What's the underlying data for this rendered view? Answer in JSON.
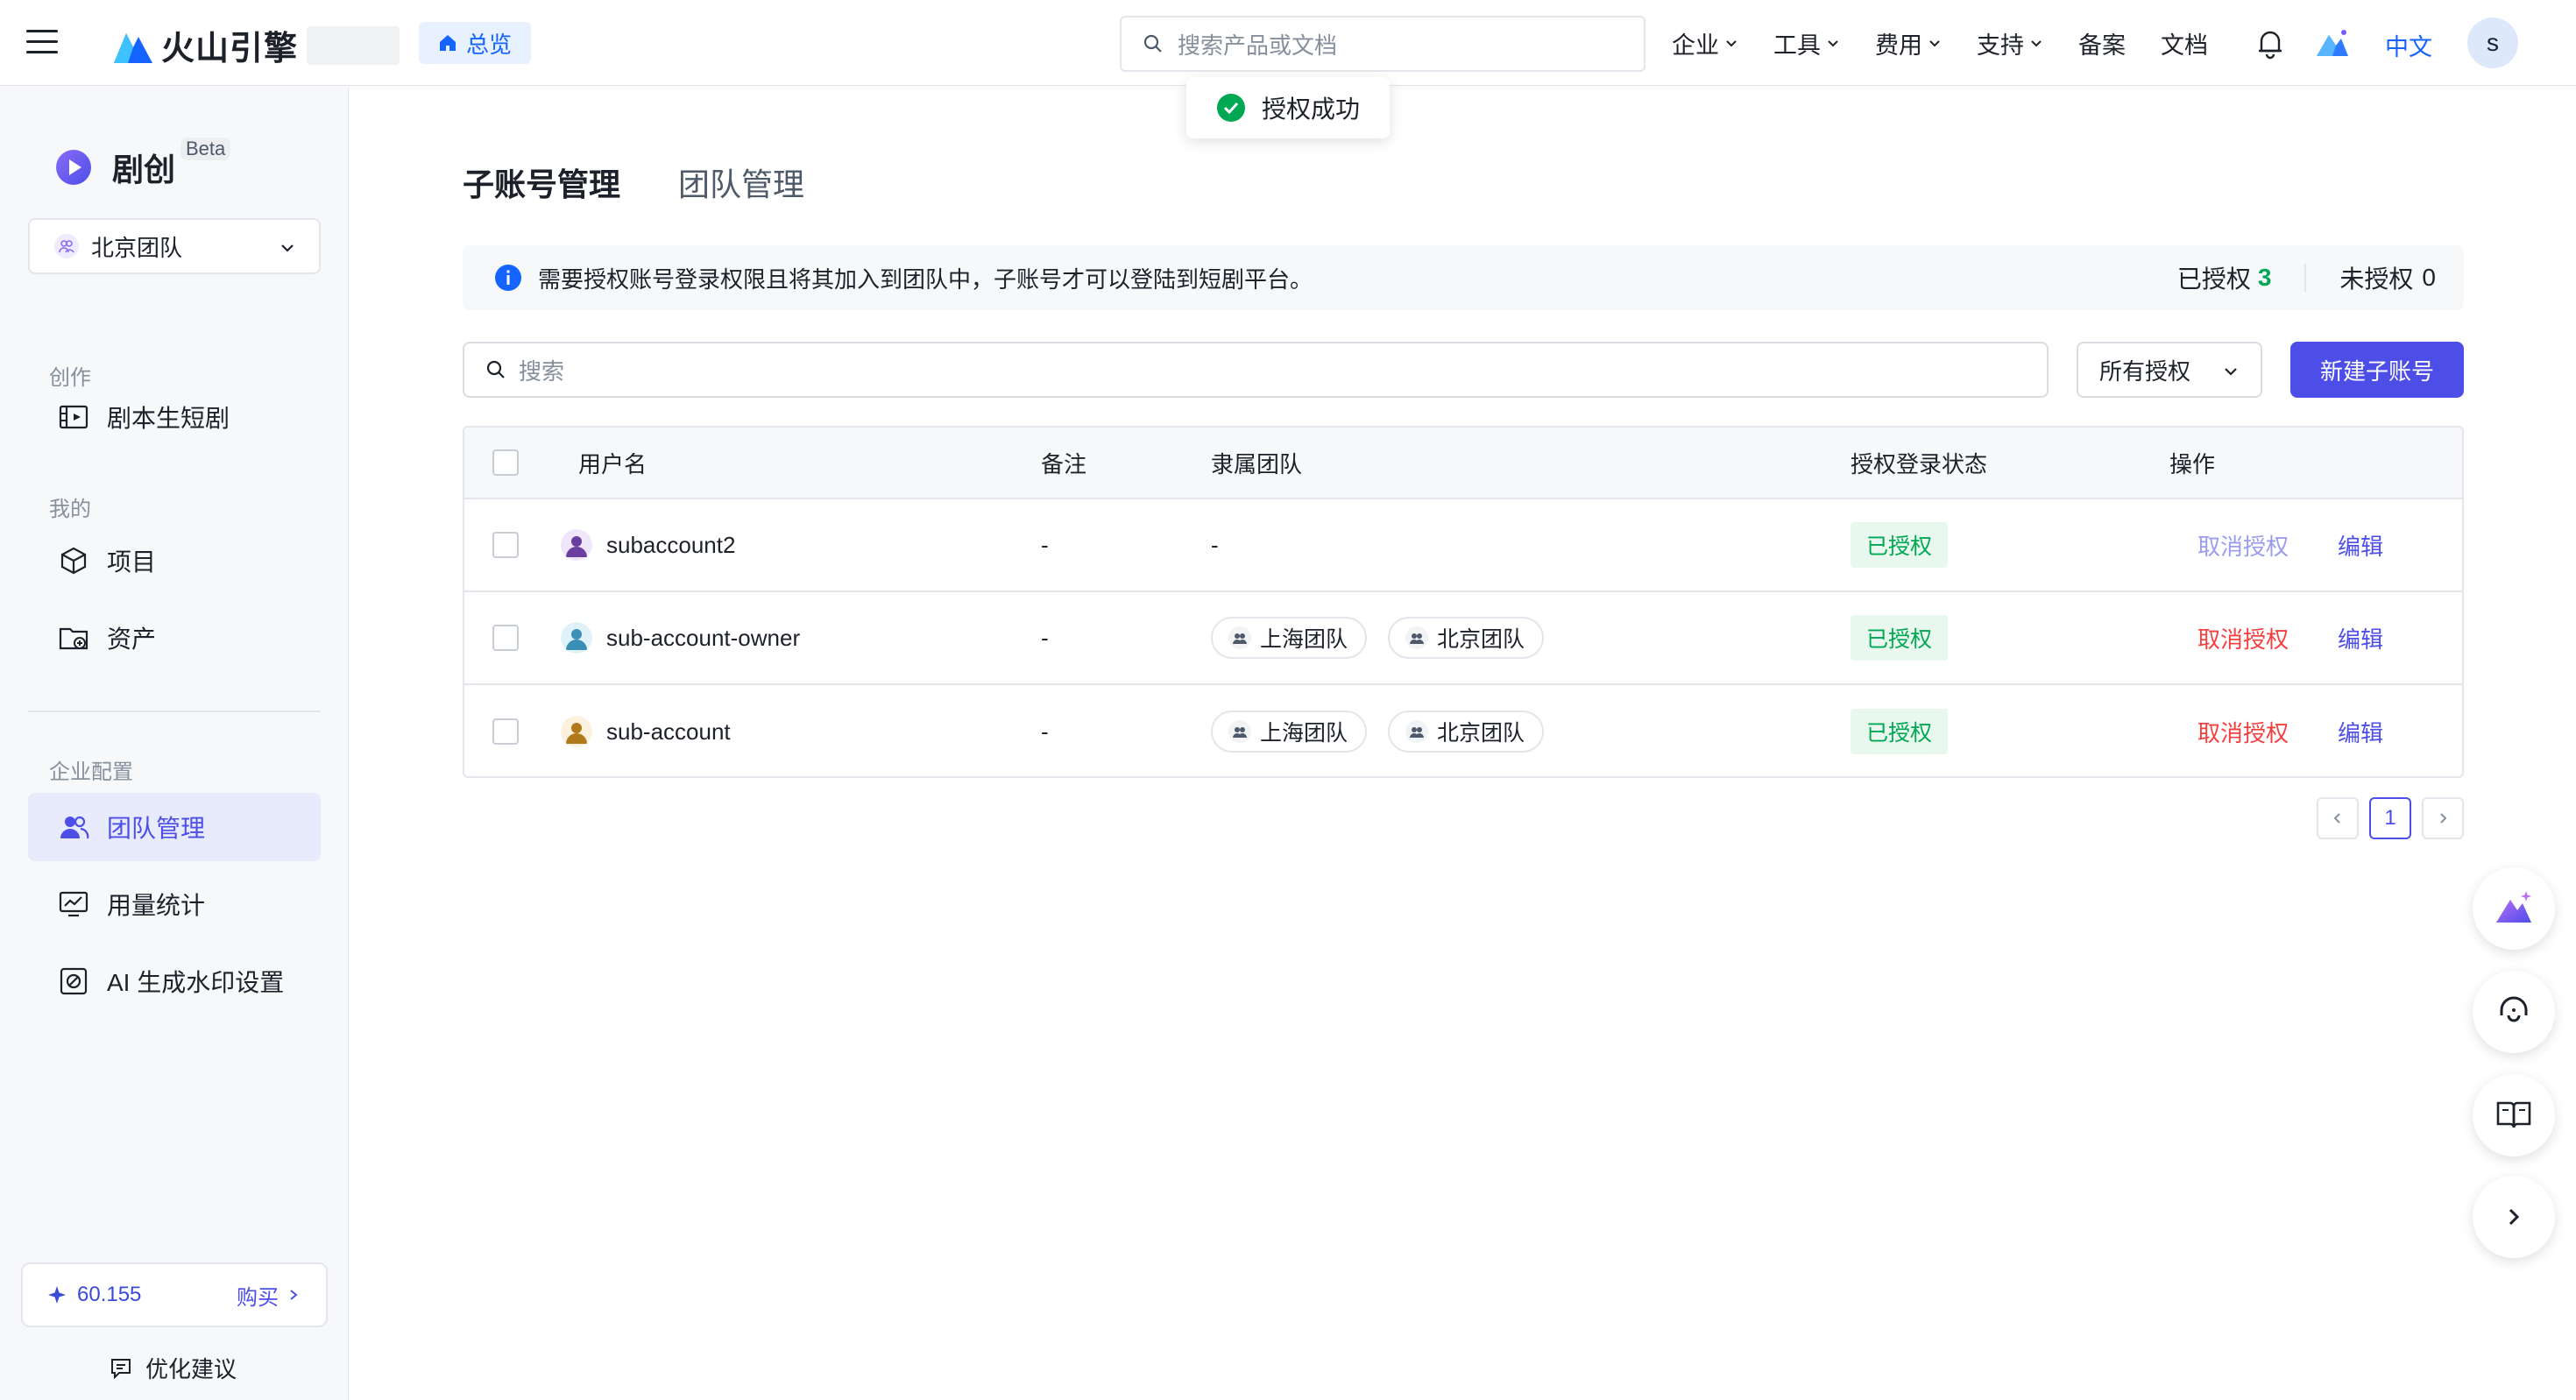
{
  "topbar": {
    "brand": "火山引擎",
    "overview": "总览",
    "search_placeholder": "搜索产品或文档",
    "nav": [
      "企业",
      "工具",
      "费用",
      "支持",
      "备案",
      "文档"
    ],
    "lang": "中文",
    "avatar": "s"
  },
  "toast": {
    "text": "授权成功"
  },
  "sidebar": {
    "brand": "剧创",
    "beta": "Beta",
    "team": "北京团队",
    "sections": {
      "create": "创作",
      "mine": "我的",
      "enterprise": "企业配置"
    },
    "items": {
      "script": "剧本生短剧",
      "project": "项目",
      "assets": "资产",
      "team": "团队管理",
      "usage": "用量统计",
      "watermark": "AI 生成水印设置"
    },
    "credits": "60.155",
    "buy": "购买",
    "feedback": "优化建议"
  },
  "main": {
    "tabs": [
      "子账号管理",
      "团队管理"
    ],
    "info": "需要授权账号登录权限且将其加入到团队中，子账号才可以登陆到短剧平台。",
    "authorized_label": "已授权",
    "authorized_count": "3",
    "unauthorized_label": "未授权",
    "unauthorized_count": "0",
    "search_placeholder": "搜索",
    "filter": "所有授权",
    "new_button": "新建子账号",
    "columns": {
      "username": "用户名",
      "remark": "备注",
      "teams": "隶属团队",
      "status": "授权登录状态",
      "actions": "操作"
    },
    "rows": [
      {
        "username": "subaccount2",
        "remark": "-",
        "teams": [
          "-"
        ],
        "status": "已授权",
        "cancel": "取消授权",
        "edit": "编辑",
        "avatar_color": "#6b3fa0"
      },
      {
        "username": "sub-account-owner",
        "remark": "-",
        "teams": [
          "上海团队",
          "北京团队"
        ],
        "status": "已授权",
        "cancel": "取消授权",
        "edit": "编辑",
        "avatar_color": "#3a8fb7"
      },
      {
        "username": "sub-account",
        "remark": "-",
        "teams": [
          "上海团队",
          "北京团队"
        ],
        "status": "已授权",
        "cancel": "取消授权",
        "edit": "编辑",
        "avatar_color": "#b07a1a"
      }
    ],
    "page": "1"
  },
  "colors": {
    "accent": "#4d4ee8",
    "link_blue": "#1664ff",
    "success": "#00a854",
    "danger": "#f53f3f"
  }
}
